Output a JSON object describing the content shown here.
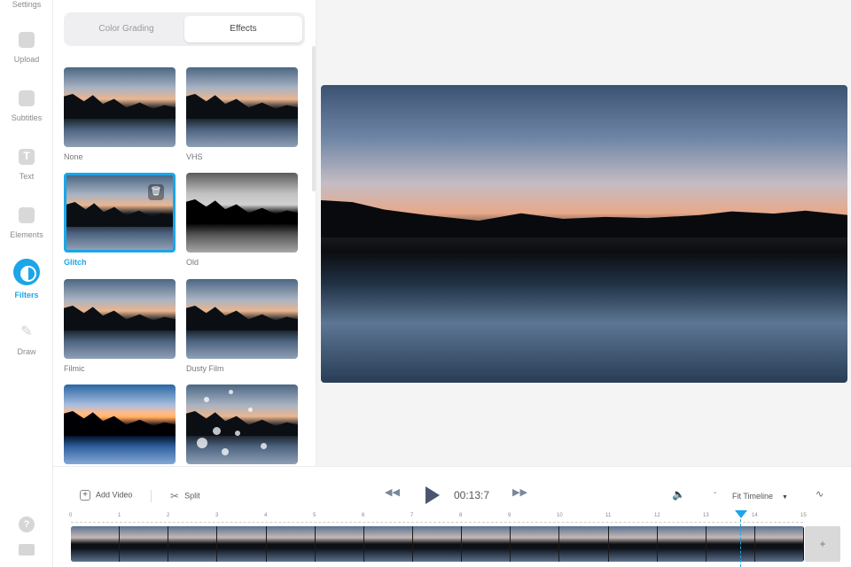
{
  "rail": {
    "items": [
      {
        "label": "Settings",
        "icon": "settings-icon"
      },
      {
        "label": "Upload",
        "icon": "upload-icon"
      },
      {
        "label": "Subtitles",
        "icon": "subtitles-icon"
      },
      {
        "label": "Text",
        "icon": "text-icon"
      },
      {
        "label": "Elements",
        "icon": "elements-icon"
      },
      {
        "label": "Filters",
        "icon": "filters-icon",
        "active": true
      },
      {
        "label": "Draw",
        "icon": "draw-icon"
      }
    ],
    "help_glyph": "?"
  },
  "filters": {
    "tabs": [
      "Color Grading",
      "Effects"
    ],
    "active_tab": "Effects",
    "items": [
      {
        "label": "None"
      },
      {
        "label": "VHS"
      },
      {
        "label": "Glitch",
        "selected": true
      },
      {
        "label": "Old"
      },
      {
        "label": "Filmic"
      },
      {
        "label": "Dusty Film"
      }
    ]
  },
  "timeline": {
    "add_video": "Add Video",
    "split": "Split",
    "timecode": "00:13:7",
    "zoom_minus": "-",
    "fit_label": "Fit Timeline",
    "add_track": "+",
    "ticks": [
      "0",
      "1",
      "2",
      "3",
      "4",
      "5",
      "6",
      "7",
      "8",
      "9",
      "10",
      "11",
      "12",
      "13",
      "14",
      "15"
    ]
  },
  "colors": {
    "accent": "#1aa6e8"
  }
}
